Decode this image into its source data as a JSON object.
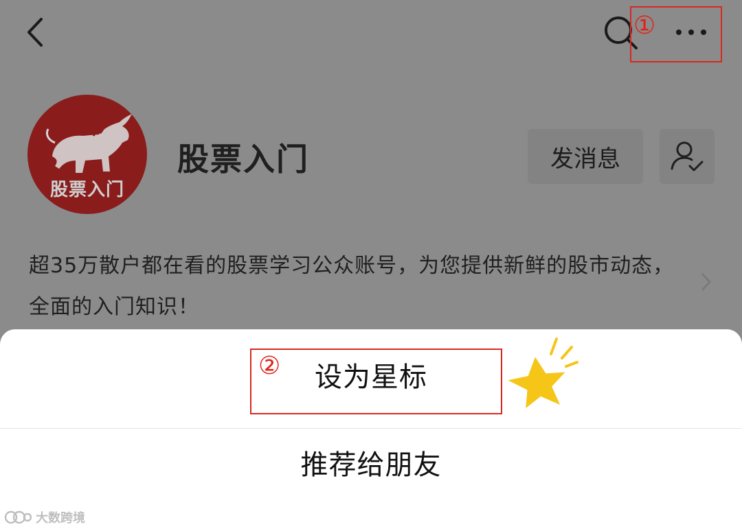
{
  "header": {
    "back_icon": "chevron-left-icon",
    "search_icon": "search-icon",
    "more_icon": "more-dots-icon"
  },
  "annotations": {
    "step1": "①",
    "step2": "②",
    "color": "#d8281f"
  },
  "profile": {
    "avatar_text": "股票入门",
    "name": "股票入门",
    "message_button": "发消息",
    "follow_icon": "user-check-icon",
    "description": "超35万散户都在看的股票学习公众账号，为您提供新鲜的股市动态，全面的入门知识！"
  },
  "sheet": {
    "items": [
      {
        "label": "设为星标"
      },
      {
        "label": "推荐给朋友"
      }
    ]
  },
  "watermark": {
    "text": "大数跨境"
  },
  "colors": {
    "overlay": "#8b8b8b",
    "sheet": "#ffffff",
    "star": "#f5c518",
    "annotation": "#d8281f"
  }
}
